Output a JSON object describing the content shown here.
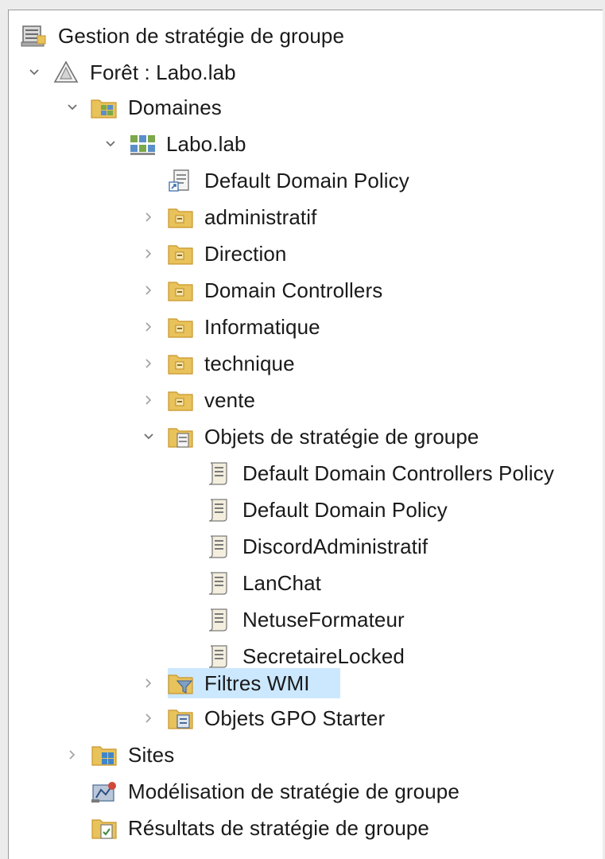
{
  "tree": {
    "root": {
      "label": "Gestion de stratégie de groupe",
      "icon": "gpmc-console-icon"
    },
    "forest": {
      "label": "Forêt : Labo.lab",
      "icon": "forest-icon",
      "expanded": true
    },
    "domains": {
      "label": "Domaines",
      "icon": "domains-folder-icon",
      "expanded": true
    },
    "domain": {
      "label": "Labo.lab",
      "icon": "domain-icon",
      "expanded": true
    },
    "domain_children": [
      {
        "label": "Default Domain Policy",
        "icon": "gpo-link-icon",
        "expandable": false
      },
      {
        "label": "administratif",
        "icon": "ou-folder-icon",
        "expandable": true
      },
      {
        "label": "Direction",
        "icon": "ou-folder-icon",
        "expandable": true
      },
      {
        "label": "Domain Controllers",
        "icon": "ou-folder-icon",
        "expandable": true
      },
      {
        "label": "Informatique",
        "icon": "ou-folder-icon",
        "expandable": true
      },
      {
        "label": "technique",
        "icon": "ou-folder-icon",
        "expandable": true
      },
      {
        "label": "vente",
        "icon": "ou-folder-icon",
        "expandable": true
      }
    ],
    "gpo_container": {
      "label": "Objets de stratégie de groupe",
      "icon": "gpo-container-icon",
      "expanded": true
    },
    "gpo_items": [
      {
        "label": "Default Domain Controllers Policy",
        "icon": "gpo-scroll-icon"
      },
      {
        "label": "Default Domain Policy",
        "icon": "gpo-scroll-icon"
      },
      {
        "label": "DiscordAdministratif",
        "icon": "gpo-scroll-icon"
      },
      {
        "label": "LanChat",
        "icon": "gpo-scroll-icon"
      },
      {
        "label": "NetuseFormateur",
        "icon": "gpo-scroll-icon"
      },
      {
        "label": "SecretaireLocked",
        "icon": "gpo-scroll-icon"
      }
    ],
    "wmi_filters": {
      "label": "Filtres WMI",
      "icon": "wmi-filter-folder-icon",
      "selected": true
    },
    "starter_gpos": {
      "label": "Objets GPO Starter",
      "icon": "starter-gpo-folder-icon"
    },
    "sites": {
      "label": "Sites",
      "icon": "sites-folder-icon"
    },
    "modeling": {
      "label": "Modélisation de stratégie de groupe",
      "icon": "modeling-icon"
    },
    "results": {
      "label": "Résultats de stratégie de groupe",
      "icon": "results-icon"
    }
  },
  "colors": {
    "selection": "#cce8ff",
    "folder": "#e8c25a",
    "folder_dark": "#c9962a",
    "text": "#1a1a1a",
    "chevron": "#6e6e6e"
  }
}
